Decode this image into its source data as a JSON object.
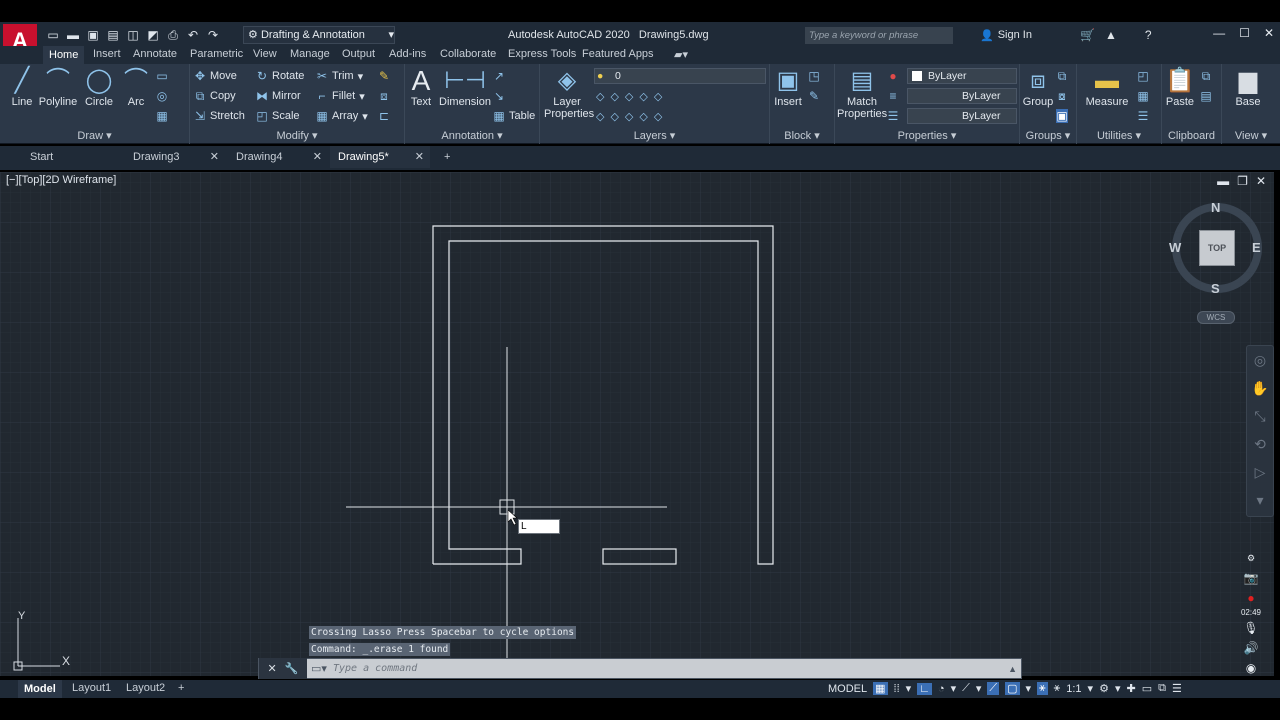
{
  "app": {
    "logo_letter": "A",
    "title": "Autodesk AutoCAD 2020",
    "file": "Drawing5.dwg",
    "workspace": "Drafting & Annotation",
    "search_placeholder": "Type a keyword or phrase",
    "sign_in": "Sign In"
  },
  "ribbon_tabs": [
    "Home",
    "Insert",
    "Annotate",
    "Parametric",
    "View",
    "Manage",
    "Output",
    "Add-ins",
    "Collaborate",
    "Express Tools",
    "Featured Apps"
  ],
  "ribbon": {
    "draw": {
      "title": "Draw",
      "line": "Line",
      "polyline": "Polyline",
      "circle": "Circle",
      "arc": "Arc"
    },
    "modify": {
      "title": "Modify",
      "move": "Move",
      "rotate": "Rotate",
      "trim": "Trim",
      "copy": "Copy",
      "mirror": "Mirror",
      "fillet": "Fillet",
      "stretch": "Stretch",
      "scale": "Scale",
      "array": "Array"
    },
    "annotation": {
      "title": "Annotation",
      "text": "Text",
      "dimension": "Dimension",
      "table": "Table"
    },
    "layers": {
      "title": "Layers",
      "layer_properties_1": "Layer",
      "layer_properties_2": "Properties",
      "current_layer": "0"
    },
    "block": {
      "title": "Block",
      "insert": "Insert"
    },
    "properties": {
      "title": "Properties",
      "match_1": "Match",
      "match_2": "Properties",
      "color": "ByLayer",
      "linetype": "ByLayer",
      "lineweight": "ByLayer"
    },
    "groups": {
      "title": "Groups",
      "group": "Group"
    },
    "utilities": {
      "title": "Utilities",
      "measure": "Measure"
    },
    "clipboard": {
      "title": "Clipboard",
      "paste": "Paste"
    },
    "view": {
      "title": "View",
      "base": "Base"
    }
  },
  "doc_tabs": [
    "Start",
    "Drawing3",
    "Drawing4",
    "Drawing5*"
  ],
  "viewport": {
    "label": "[−][Top][2D Wireframe]",
    "navcube_face": "TOP",
    "compass": {
      "n": "N",
      "s": "S",
      "e": "E",
      "w": "W"
    },
    "ucs_label": "WCS",
    "ucs_y": "Y",
    "ucs_x": "X",
    "dynamic_input": "L",
    "timer": "02:49"
  },
  "command": {
    "history_1": "Crossing Lasso  Press Spacebar to cycle options",
    "history_2": "Command: _.erase 1 found",
    "prompt": "Type a command"
  },
  "status": {
    "layout_tabs": [
      "Model",
      "Layout1",
      "Layout2"
    ],
    "model_label": "MODEL",
    "scale": "1:1"
  },
  "colors": {
    "canvas": "#212830",
    "ribbon": "#2c3848",
    "accent": "#3b6fb5",
    "logo": "#c8102e"
  }
}
